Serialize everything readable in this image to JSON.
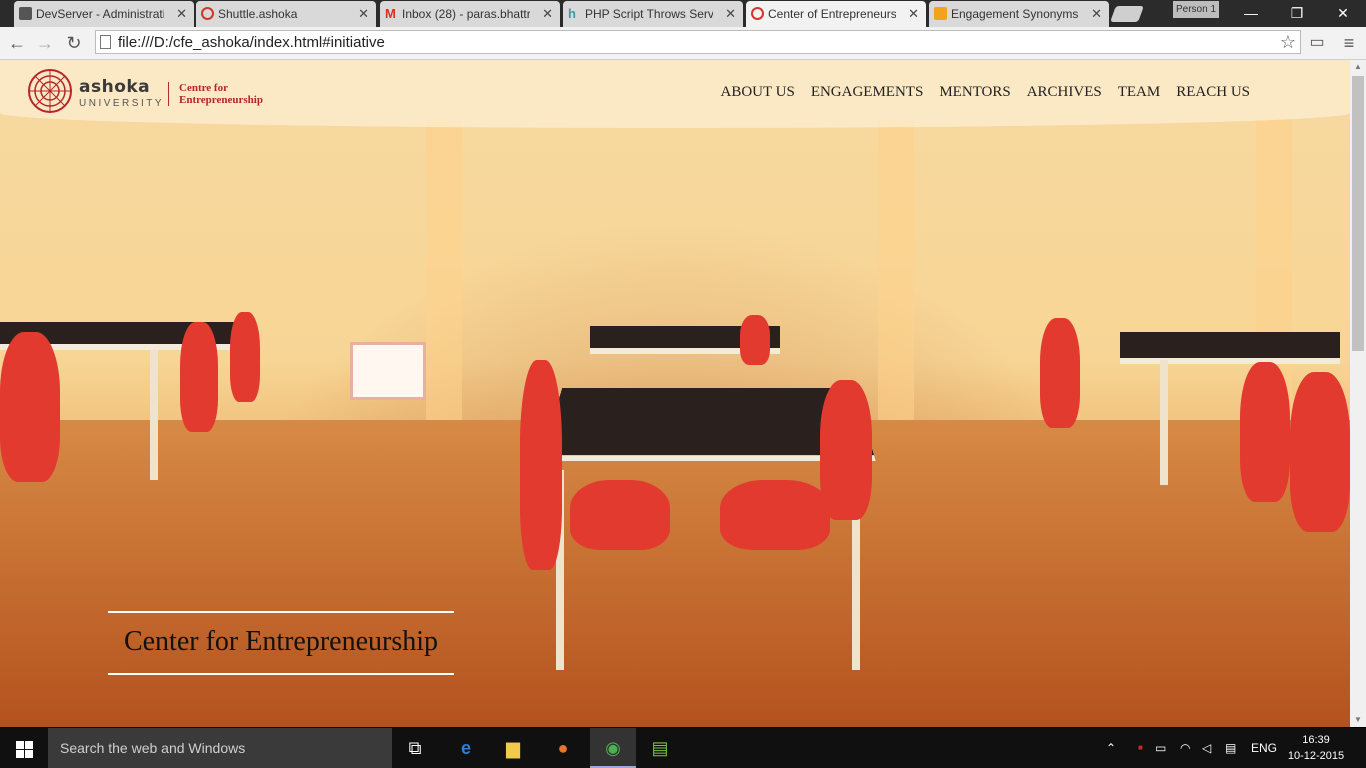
{
  "browser": {
    "tabs": [
      {
        "title": "DevServer - Administrati",
        "favicon_color": "#555555",
        "active": false
      },
      {
        "title": "Shuttle.ashoka",
        "favicon_color": "#d0362b",
        "active": false
      },
      {
        "title": "Inbox (28) - paras.bhattr",
        "favicon_color": "#d93025",
        "active": false
      },
      {
        "title": "PHP Script Throws Serve",
        "favicon_color": "#3aa0a0",
        "active": false
      },
      {
        "title": "Center of Entrepreneursl",
        "favicon_color": "#d0362b",
        "active": true
      },
      {
        "title": "Engagement Synonyms,",
        "favicon_color": "#f2a31b",
        "active": false
      }
    ],
    "profile_label": "Person 1",
    "url": "file:///D:/cfe_ashoka/index.html#initiative"
  },
  "site": {
    "logo": {
      "name": "ashoka",
      "sub": "UNIVERSITY",
      "cfe_line1": "Centre for",
      "cfe_line2": "Entrepreneurship"
    },
    "nav": [
      "ABOUT US",
      "ENGAGEMENTS",
      "MENTORS",
      "ARCHIVES",
      "TEAM",
      "REACH US"
    ],
    "hero_caption": "Center for Entrepreneurship",
    "brand_color": "#b5252a"
  },
  "taskbar": {
    "search_placeholder": "Search the web and Windows",
    "language": "ENG",
    "time": "16:39",
    "date": "10-12-2015"
  }
}
